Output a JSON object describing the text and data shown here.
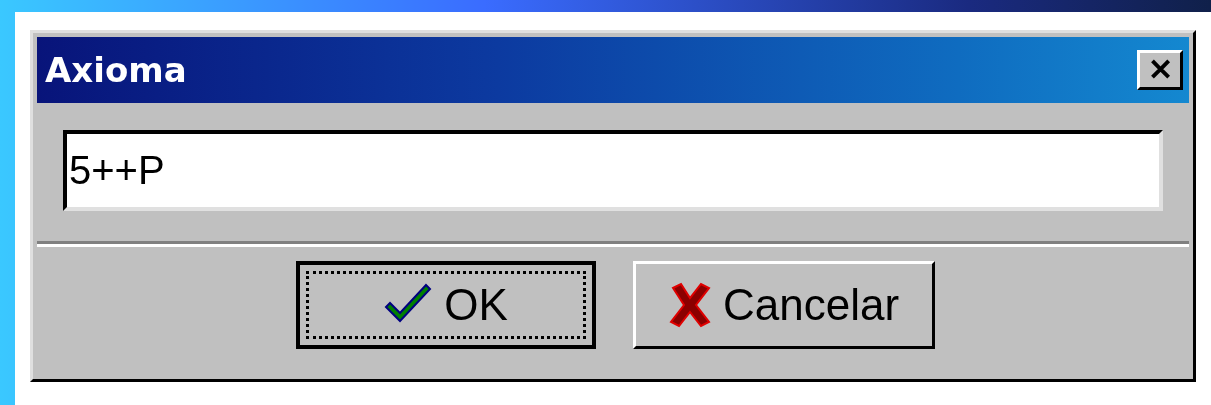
{
  "window": {
    "title": "Axioma",
    "close": "✕"
  },
  "field": {
    "value": "5++P"
  },
  "buttons": [
    {
      "label": "OK",
      "kind": "ok",
      "default": true
    },
    {
      "label": "Cancelar",
      "kind": "cancel",
      "default": false
    }
  ]
}
